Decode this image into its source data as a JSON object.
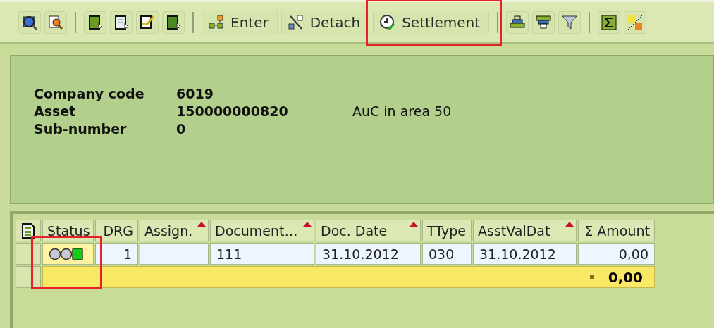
{
  "toolbar": [
    {
      "kind": "icon",
      "highlighted": false
    },
    {
      "kind": "icon",
      "highlighted": false
    },
    {
      "kind": "separator"
    },
    {
      "kind": "icon",
      "highlighted": false
    },
    {
      "kind": "icon",
      "highlighted": false
    },
    {
      "kind": "icon",
      "highlighted": false
    },
    {
      "kind": "icon",
      "highlighted": false
    },
    {
      "kind": "separator"
    },
    {
      "kind": "text",
      "label": "Enter",
      "highlighted": false
    },
    {
      "kind": "text",
      "label": "Detach",
      "highlighted": false
    },
    {
      "kind": "text",
      "label": "Settlement",
      "highlighted": true
    },
    {
      "kind": "separator"
    },
    {
      "kind": "icon",
      "highlighted": false
    },
    {
      "kind": "icon",
      "highlighted": false
    },
    {
      "kind": "icon",
      "highlighted": false
    },
    {
      "kind": "separator"
    },
    {
      "kind": "icon",
      "highlighted": false
    },
    {
      "kind": "icon",
      "highlighted": false
    }
  ],
  "header": {
    "fields": [
      {
        "label": "Company code",
        "value": "6019"
      },
      {
        "label": "Asset",
        "value": "150000000820",
        "note": "AuC in area 50"
      },
      {
        "label": "Sub-number",
        "value": "0"
      }
    ]
  },
  "table": {
    "status_column": {
      "label": "Status"
    },
    "columns": [
      {
        "label": "DRG",
        "sorted": false
      },
      {
        "label": "Assign.",
        "sorted": true
      },
      {
        "label": "Document…",
        "sorted": true
      },
      {
        "label": "Doc. Date",
        "sorted": true
      },
      {
        "label": "TType",
        "sorted": false
      },
      {
        "label": "AsstValDat",
        "sorted": true
      },
      {
        "label": "Σ Amount",
        "sorted": false
      }
    ],
    "rows": [
      {
        "lights": [
          {
            "on": false
          },
          {
            "on": false
          },
          {
            "on": true
          }
        ],
        "highlighted": true,
        "cells": [
          "1",
          "",
          "111",
          "31.10.2012",
          "030",
          "31.10.2012",
          "0,00"
        ]
      }
    ],
    "total": {
      "value": "0,00"
    }
  }
}
